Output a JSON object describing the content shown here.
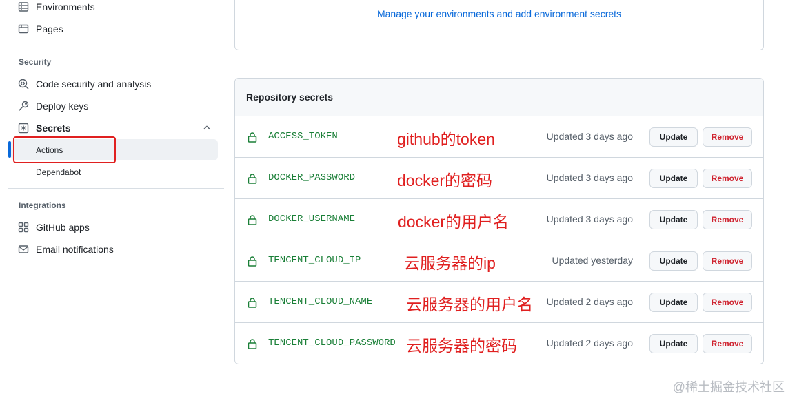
{
  "sidebar": {
    "top_items": [
      {
        "label": "Environments",
        "icon": "server-icon"
      },
      {
        "label": "Pages",
        "icon": "browser-icon"
      }
    ],
    "security": {
      "title": "Security",
      "code_security": "Code security and analysis",
      "deploy_keys": "Deploy keys",
      "secrets": "Secrets",
      "sub_items": [
        "Actions",
        "Dependabot"
      ]
    },
    "integrations": {
      "title": "Integrations",
      "github_apps": "GitHub apps",
      "email_notifications": "Email notifications"
    }
  },
  "environments_card": {
    "link": "Manage your environments and add environment secrets"
  },
  "secrets_panel": {
    "title": "Repository secrets",
    "update_label": "Update",
    "remove_label": "Remove",
    "rows": [
      {
        "name": "ACCESS_TOKEN",
        "note": "github的token",
        "updated": "Updated 3 days ago"
      },
      {
        "name": "DOCKER_PASSWORD",
        "note": "docker的密码",
        "updated": "Updated 3 days ago"
      },
      {
        "name": "DOCKER_USERNAME",
        "note": "docker的用户名",
        "updated": "Updated 3 days ago"
      },
      {
        "name": "TENCENT_CLOUD_IP",
        "note": "云服务器的ip",
        "updated": "Updated yesterday"
      },
      {
        "name": "TENCENT_CLOUD_NAME",
        "note": "云服务器的用户名",
        "updated": "Updated 2 days ago"
      },
      {
        "name": "TENCENT_CLOUD_PASSWORD",
        "note": "云服务器的密码",
        "updated": "Updated 2 days ago"
      }
    ]
  },
  "watermark": "@稀土掘金技术社区",
  "colors": {
    "link": "#0969da",
    "secret_name": "#1a7f37",
    "annotation": "#e02020",
    "remove": "#cf222e"
  }
}
